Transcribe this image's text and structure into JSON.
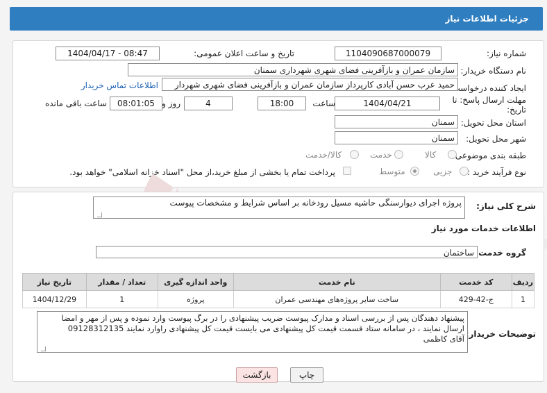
{
  "header": {
    "title": "جزئیات اطلاعات نیاز"
  },
  "form": {
    "need_number_label": "شماره نیاز:",
    "need_number": "1104090687000079",
    "announce_label": "تاریخ و ساعت اعلان عمومی:",
    "announce_value": "1404/04/17 - 08:47",
    "buyer_org_label": "نام دستگاه خریدار:",
    "buyer_org": "سازمان عمران و بازآفرینی فضای شهری شهرداری سمنان",
    "creator_label": "ایجاد کننده درخواست:",
    "creator": "حمید عرب حسن آبادی کارپرداز سازمان عمران و بازآفرینی فضای شهری شهردار",
    "contact_link": "اطلاعات تماس خریدار",
    "deadline_label": "مهلت ارسال پاسخ: تا تاریخ:",
    "deadline_date": "1404/04/21",
    "time_label": "ساعت",
    "deadline_time": "18:00",
    "days_value": "4",
    "days_label": "روز و",
    "remaining_time": "08:01:05",
    "remaining_label": "ساعت باقی مانده",
    "province_label": "استان محل تحویل:",
    "province": "سمنان",
    "city_label": "شهر محل تحویل:",
    "city": "سمنان",
    "category_label": "طبقه بندی موضوعی:",
    "category_options": [
      "کالا",
      "خدمت",
      "کالا/خدمت"
    ],
    "process_label": "نوع فرآیند خرید :",
    "process_options": [
      "جزیی",
      "متوسط"
    ],
    "payment_note": "پرداخت تمام یا بخشی از مبلغ خرید،از محل \"اسناد خزانه اسلامی\" خواهد بود."
  },
  "summary": {
    "label": "شرح کلی نیاز:",
    "text": "پروژه اجرای دیوارسنگی حاشیه مسیل رودخانه بر اساس شرایط و مشخصات پیوست"
  },
  "services": {
    "section_title": "اطلاعات خدمات مورد نیاز",
    "group_label": "گروه خدمت:",
    "group_value": "ساختمان",
    "columns": [
      "ردیف",
      "کد خدمت",
      "نام خدمت",
      "واحد اندازه گیری",
      "تعداد / مقدار",
      "تاریخ نیاز"
    ],
    "rows": [
      [
        "1",
        "ج-42-429",
        "ساخت سایر پروژه‌های مهندسی عمران",
        "پروژه",
        "1",
        "1404/12/29"
      ]
    ]
  },
  "notes": {
    "label": "توضیحات خریدار:",
    "lines": [
      "پیشنهاد دهندگان پس از بررسی اسناد و مدارک پیوست ضریب پیشنهادی را در برگ پیوست وارد نموده و پس از مهر و امضا",
      "ارسال نمایند ، در سامانه ستاد قسمت قیمت کل پیشنهادی می بایست قیمت کل پیشنهادی راوارد نمایند 09128312135",
      "آقای کاظمی"
    ]
  },
  "buttons": {
    "print": "چاپ",
    "back": "بازگشت"
  },
  "watermark": {
    "text": "AriaTender.neT"
  }
}
